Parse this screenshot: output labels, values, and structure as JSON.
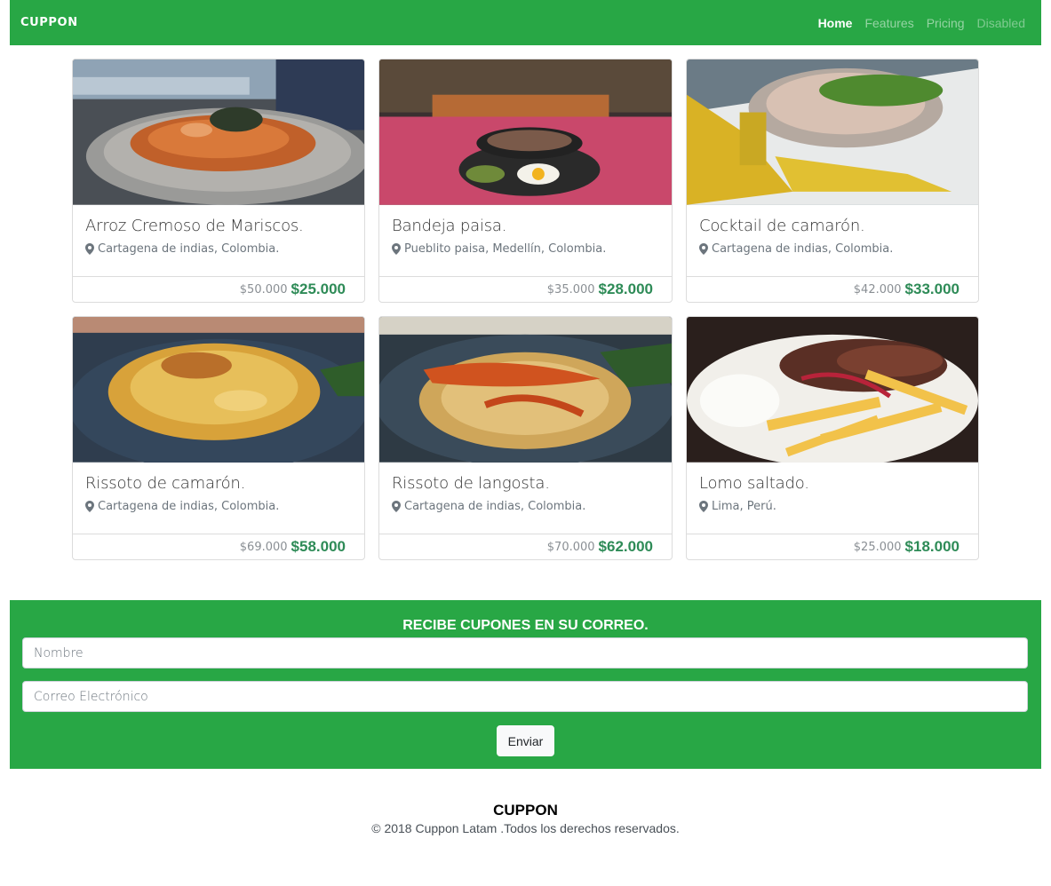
{
  "navbar": {
    "brand": "CUPPON",
    "links": [
      {
        "label": "Home"
      },
      {
        "label": "Features"
      },
      {
        "label": "Pricing"
      },
      {
        "label": "Disabled"
      }
    ]
  },
  "cards": [
    {
      "title": "Arroz Cremoso de Mariscos.",
      "location": "Cartagena de indias, Colombia.",
      "old_price": "$50.000",
      "new_price": "$25.000"
    },
    {
      "title": "Bandeja paisa.",
      "location": "Pueblito paisa, Medellín, Colombia.",
      "old_price": "$35.000",
      "new_price": "$28.000"
    },
    {
      "title": "Cocktail de camarón.",
      "location": "Cartagena de indias, Colombia.",
      "old_price": "$42.000",
      "new_price": "$33.000"
    },
    {
      "title": "Rissoto de camarón.",
      "location": "Cartagena de indias, Colombia.",
      "old_price": "$69.000",
      "new_price": "$58.000"
    },
    {
      "title": "Rissoto de langosta.",
      "location": "Cartagena de indias, Colombia.",
      "old_price": "$70.000",
      "new_price": "$62.000"
    },
    {
      "title": "Lomo saltado.",
      "location": "Lima, Perú.",
      "old_price": "$25.000",
      "new_price": "$18.000"
    }
  ],
  "subscribe": {
    "title": "RECIBE CUPONES EN SU CORREO.",
    "name_placeholder": "Nombre",
    "email_placeholder": "Correo Electrónico",
    "button_label": "Enviar"
  },
  "footer": {
    "brand": "CUPPON",
    "copyright": "© 2018 Cuppon Latam .Todos los derechos reservados."
  },
  "colors": {
    "brand_green": "#28a745",
    "price_green": "#2e8b57"
  }
}
